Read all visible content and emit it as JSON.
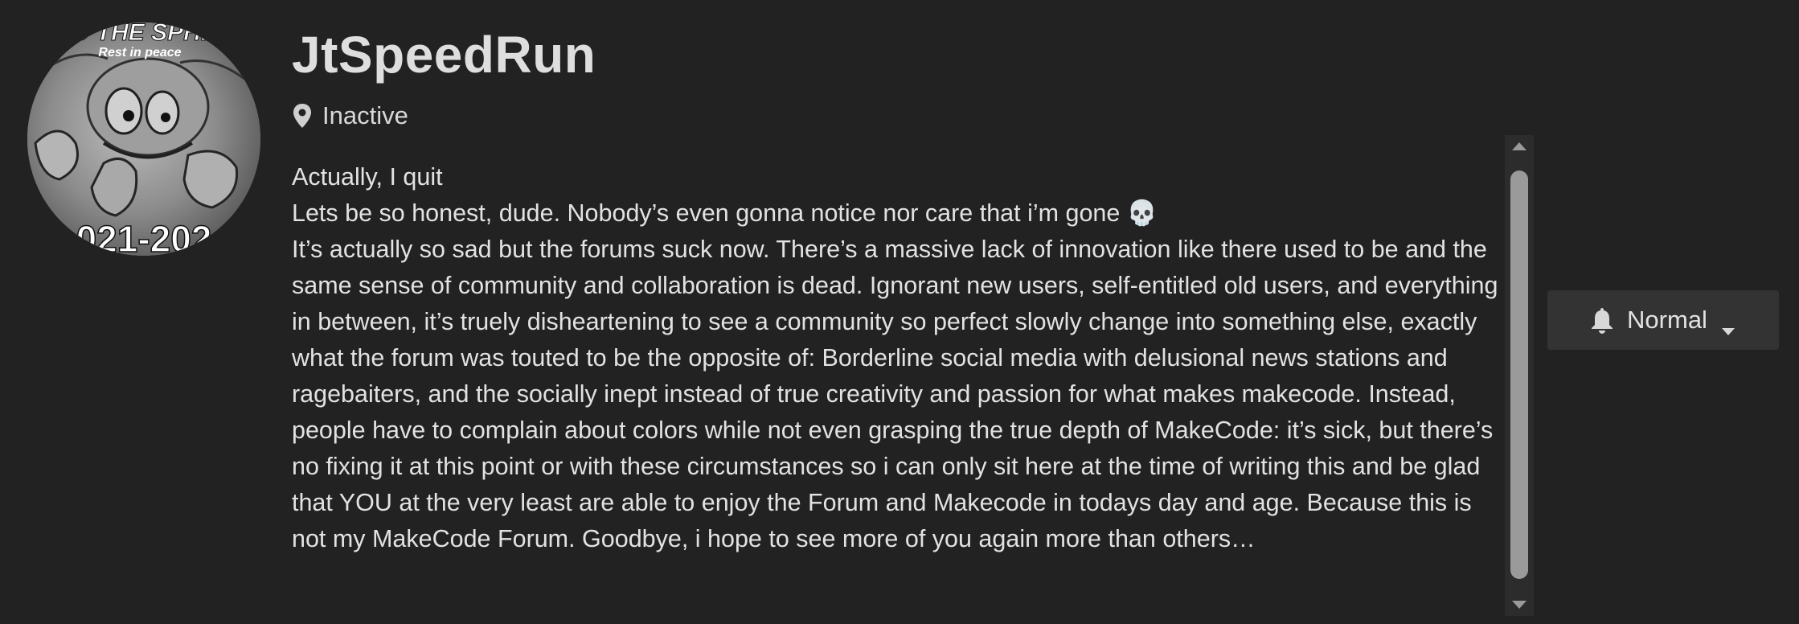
{
  "user": {
    "username": "JtSpeedRun",
    "status": "Inactive",
    "avatar": {
      "top_text": "O THE SPHE",
      "subtitle": "Rest in peace",
      "bottom_text": "021-202"
    }
  },
  "bio": {
    "lines": [
      "Actually, I quit",
      "Lets be so honest, dude. Nobody’s even gonna notice nor care that i’m gone 💀",
      "It’s actually so sad but the forums suck now. There’s a massive lack of innovation like there used to be and the same sense of community and collaboration is dead. Ignorant new users, self-entitled old users, and everything in between, it’s truely disheartening to see a community so perfect slowly change into something else, exactly what the forum was touted to be the opposite of: Borderline social media with delusional news stations and ragebaiters, and the socially inept instead of true creativity and passion for what makes makecode. Instead, people have to complain about colors while not even grasping the true depth of MakeCode: it’s sick, but there’s no fixing it at this point or with these circumstances so i can only sit here at the time of writing this and be glad that YOU at the very least are able to enjoy the Forum and Makecode in todays day and age. Because this is not my MakeCode Forum. Goodbye, i hope to see more of you again more than others…"
    ]
  },
  "notifications": {
    "level_label": "Normal",
    "icon": "bell-icon"
  },
  "colors": {
    "background": "#222222",
    "text": "#e2e2e2",
    "button_bg": "#333333",
    "scroll_thumb": "#9a9a9a"
  }
}
